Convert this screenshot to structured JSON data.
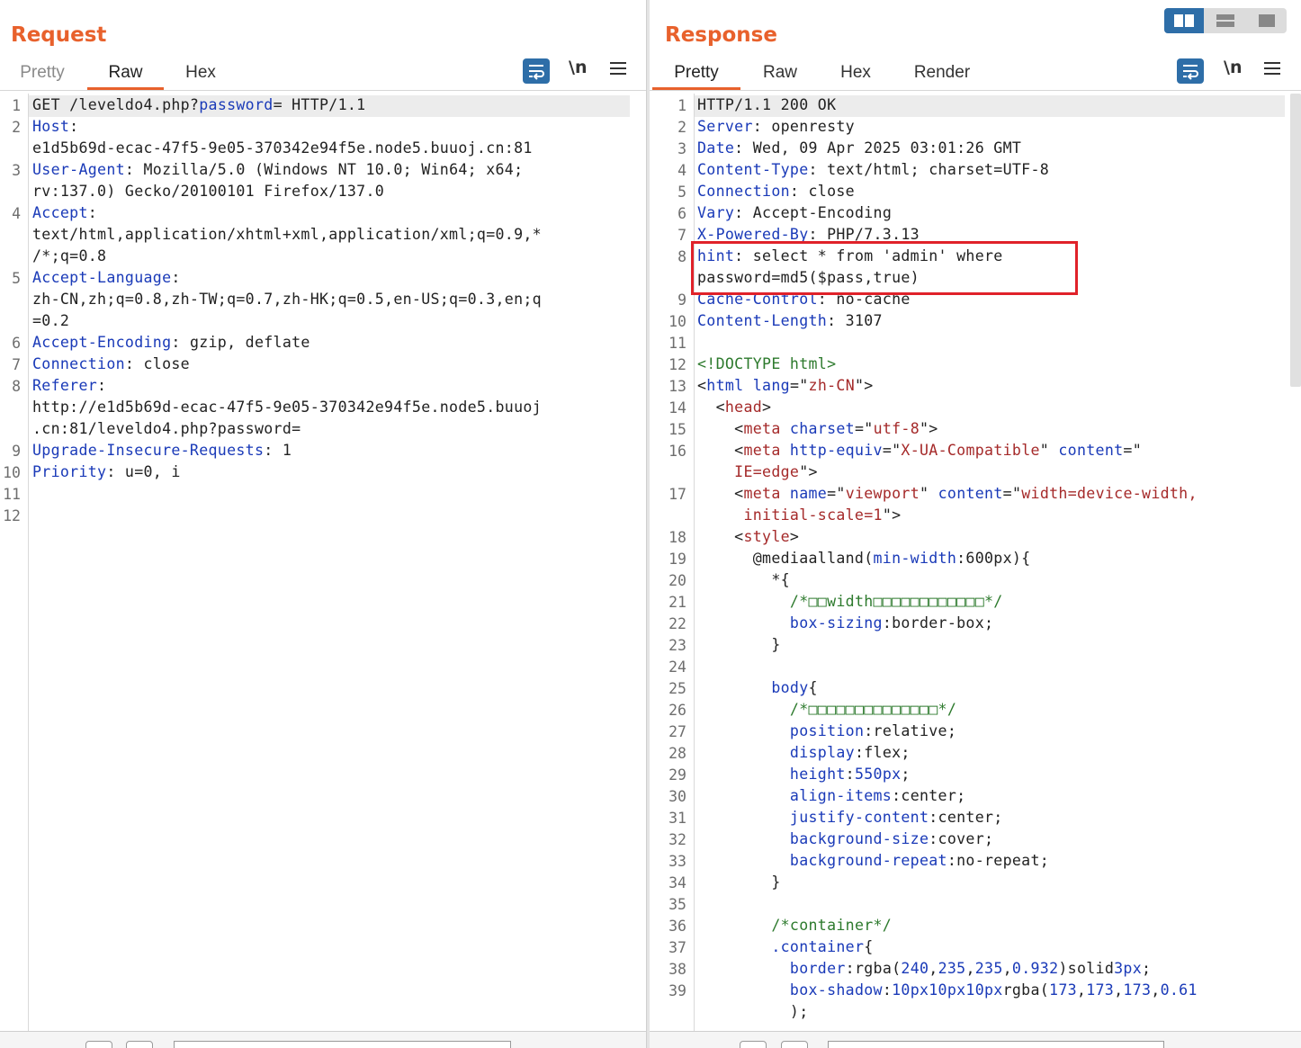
{
  "request": {
    "title": "Request",
    "tabs": [
      "Pretty",
      "Raw",
      "Hex"
    ],
    "active_tab": "Raw",
    "newline_toggle": "\\n",
    "lines": [
      {
        "n": "1",
        "segs": [
          [
            "",
            "GET /leveldo4.php?"
          ],
          [
            "k",
            "password"
          ],
          [
            "",
            "= HTTP/1.1"
          ]
        ]
      },
      {
        "n": "2",
        "segs": [
          [
            "k",
            "Host"
          ],
          [
            "",
            ":"
          ]
        ]
      },
      {
        "n": "",
        "segs": [
          [
            "",
            "e1d5b69d-ecac-47f5-9e05-370342e94f5e.node5.buuoj.cn:81"
          ]
        ]
      },
      {
        "n": "3",
        "segs": [
          [
            "k",
            "User-Agent"
          ],
          [
            "",
            ": Mozilla/5.0 (Windows NT 10.0; Win64; x64;"
          ]
        ]
      },
      {
        "n": "",
        "segs": [
          [
            "",
            "rv:137.0) Gecko/20100101 Firefox/137.0"
          ]
        ]
      },
      {
        "n": "4",
        "segs": [
          [
            "k",
            "Accept"
          ],
          [
            "",
            ":"
          ]
        ]
      },
      {
        "n": "",
        "segs": [
          [
            "",
            "text/html,application/xhtml+xml,application/xml;q=0.9,*"
          ]
        ]
      },
      {
        "n": "",
        "segs": [
          [
            "",
            "/*;q=0.8"
          ]
        ]
      },
      {
        "n": "5",
        "segs": [
          [
            "k",
            "Accept-Language"
          ],
          [
            "",
            ":"
          ]
        ]
      },
      {
        "n": "",
        "segs": [
          [
            "",
            "zh-CN,zh;q=0.8,zh-TW;q=0.7,zh-HK;q=0.5,en-US;q=0.3,en;q"
          ]
        ]
      },
      {
        "n": "",
        "segs": [
          [
            "",
            "=0.2"
          ]
        ]
      },
      {
        "n": "6",
        "segs": [
          [
            "k",
            "Accept-Encoding"
          ],
          [
            "",
            ": gzip, deflate"
          ]
        ]
      },
      {
        "n": "7",
        "segs": [
          [
            "k",
            "Connection"
          ],
          [
            "",
            ": close"
          ]
        ]
      },
      {
        "n": "8",
        "segs": [
          [
            "k",
            "Referer"
          ],
          [
            "",
            ":"
          ]
        ]
      },
      {
        "n": "",
        "segs": [
          [
            "",
            "http://e1d5b69d-ecac-47f5-9e05-370342e94f5e.node5.buuoj"
          ]
        ]
      },
      {
        "n": "",
        "segs": [
          [
            "",
            ".cn:81/leveldo4.php?password="
          ]
        ]
      },
      {
        "n": "9",
        "segs": [
          [
            "k",
            "Upgrade-Insecure-Requests"
          ],
          [
            "",
            ": 1"
          ]
        ]
      },
      {
        "n": "10",
        "segs": [
          [
            "k",
            "Priority"
          ],
          [
            "",
            ": u=0, i"
          ]
        ]
      },
      {
        "n": "11",
        "segs": []
      },
      {
        "n": "12",
        "segs": []
      }
    ]
  },
  "response": {
    "title": "Response",
    "tabs": [
      "Pretty",
      "Raw",
      "Hex",
      "Render"
    ],
    "active_tab": "Pretty",
    "newline_toggle": "\\n",
    "lines": [
      {
        "n": "1",
        "segs": [
          [
            "",
            "HTTP/1.1 200 OK"
          ]
        ]
      },
      {
        "n": "2",
        "segs": [
          [
            "k",
            "Server"
          ],
          [
            "",
            ": openresty"
          ]
        ]
      },
      {
        "n": "3",
        "segs": [
          [
            "k",
            "Date"
          ],
          [
            "",
            ": Wed, 09 Apr 2025 03:01:26 GMT"
          ]
        ]
      },
      {
        "n": "4",
        "segs": [
          [
            "k",
            "Content-Type"
          ],
          [
            "",
            ": text/html; charset=UTF-8"
          ]
        ]
      },
      {
        "n": "5",
        "segs": [
          [
            "k",
            "Connection"
          ],
          [
            "",
            ": close"
          ]
        ]
      },
      {
        "n": "6",
        "segs": [
          [
            "k",
            "Vary"
          ],
          [
            "",
            ": Accept-Encoding"
          ]
        ]
      },
      {
        "n": "7",
        "segs": [
          [
            "k",
            "X-Powered-By"
          ],
          [
            "",
            ": PHP/7.3.13"
          ]
        ]
      },
      {
        "n": "8",
        "segs": [
          [
            "k",
            "hint"
          ],
          [
            "",
            ": select * from 'admin' where"
          ]
        ]
      },
      {
        "n": "",
        "segs": [
          [
            "",
            "password=md5($pass,true)"
          ]
        ]
      },
      {
        "n": "9",
        "segs": [
          [
            "k",
            "Cache-Control"
          ],
          [
            "",
            ": no-cache"
          ]
        ]
      },
      {
        "n": "10",
        "segs": [
          [
            "k",
            "Content-Length"
          ],
          [
            "",
            ": 3107"
          ]
        ]
      },
      {
        "n": "11",
        "segs": []
      },
      {
        "n": "12",
        "segs": [
          [
            "g",
            "<!DOCTYPE html>"
          ]
        ]
      },
      {
        "n": "13",
        "segs": [
          [
            "",
            "<"
          ],
          [
            "k",
            "html"
          ],
          [
            "",
            " "
          ],
          [
            "k",
            "lang"
          ],
          [
            "",
            "=\""
          ],
          [
            "s",
            "zh-CN"
          ],
          [
            "",
            "\">"
          ]
        ]
      },
      {
        "n": "14",
        "segs": [
          [
            "",
            "  <"
          ],
          [
            "s",
            "head"
          ],
          [
            "",
            ">"
          ]
        ]
      },
      {
        "n": "15",
        "segs": [
          [
            "",
            "    <"
          ],
          [
            "s",
            "meta"
          ],
          [
            "",
            " "
          ],
          [
            "k",
            "charset"
          ],
          [
            "",
            "=\""
          ],
          [
            "s",
            "utf-8"
          ],
          [
            "",
            "\">"
          ]
        ]
      },
      {
        "n": "16",
        "segs": [
          [
            "",
            "    <"
          ],
          [
            "s",
            "meta"
          ],
          [
            "",
            " "
          ],
          [
            "k",
            "http-equiv"
          ],
          [
            "",
            "=\""
          ],
          [
            "s",
            "X-UA-Compatible"
          ],
          [
            "",
            "\" "
          ],
          [
            "k",
            "content"
          ],
          [
            "",
            "=\""
          ]
        ]
      },
      {
        "n": "",
        "segs": [
          [
            "",
            "    "
          ],
          [
            "s",
            "IE=edge"
          ],
          [
            "",
            "\">"
          ]
        ]
      },
      {
        "n": "17",
        "segs": [
          [
            "",
            "    <"
          ],
          [
            "s",
            "meta"
          ],
          [
            "",
            " "
          ],
          [
            "k",
            "name"
          ],
          [
            "",
            "=\""
          ],
          [
            "s",
            "viewport"
          ],
          [
            "",
            "\" "
          ],
          [
            "k",
            "content"
          ],
          [
            "",
            "=\""
          ],
          [
            "s",
            "width=device-width,"
          ]
        ]
      },
      {
        "n": "",
        "segs": [
          [
            "",
            "     "
          ],
          [
            "s",
            "initial-scale=1"
          ],
          [
            "",
            "\">"
          ]
        ]
      },
      {
        "n": "18",
        "segs": [
          [
            "",
            "    <"
          ],
          [
            "s",
            "style"
          ],
          [
            "",
            ">"
          ]
        ]
      },
      {
        "n": "19",
        "segs": [
          [
            "",
            "      @mediaalland("
          ],
          [
            "k",
            "min-width"
          ],
          [
            "",
            ":600px){"
          ]
        ]
      },
      {
        "n": "20",
        "segs": [
          [
            "",
            "        *{"
          ]
        ]
      },
      {
        "n": "21",
        "segs": [
          [
            "",
            "          "
          ],
          [
            "g",
            "/*□□width□□□□□□□□□□□□*/"
          ]
        ]
      },
      {
        "n": "22",
        "segs": [
          [
            "",
            "          "
          ],
          [
            "k",
            "box-sizing"
          ],
          [
            "",
            ":border-box;"
          ]
        ]
      },
      {
        "n": "23",
        "segs": [
          [
            "",
            "        }"
          ]
        ]
      },
      {
        "n": "24",
        "segs": []
      },
      {
        "n": "25",
        "segs": [
          [
            "",
            "        "
          ],
          [
            "k",
            "body"
          ],
          [
            "",
            "{"
          ]
        ]
      },
      {
        "n": "26",
        "segs": [
          [
            "",
            "          "
          ],
          [
            "g",
            "/*□□□□□□□□□□□□□□*/"
          ]
        ]
      },
      {
        "n": "27",
        "segs": [
          [
            "",
            "          "
          ],
          [
            "k",
            "position"
          ],
          [
            "",
            ":relative;"
          ]
        ]
      },
      {
        "n": "28",
        "segs": [
          [
            "",
            "          "
          ],
          [
            "k",
            "display"
          ],
          [
            "",
            ":flex;"
          ]
        ]
      },
      {
        "n": "29",
        "segs": [
          [
            "",
            "          "
          ],
          [
            "k",
            "height"
          ],
          [
            "",
            ":"
          ],
          [
            "n",
            "550px"
          ],
          [
            "",
            ";"
          ]
        ]
      },
      {
        "n": "30",
        "segs": [
          [
            "",
            "          "
          ],
          [
            "k",
            "align-items"
          ],
          [
            "",
            ":center;"
          ]
        ]
      },
      {
        "n": "31",
        "segs": [
          [
            "",
            "          "
          ],
          [
            "k",
            "justify-content"
          ],
          [
            "",
            ":center;"
          ]
        ]
      },
      {
        "n": "32",
        "segs": [
          [
            "",
            "          "
          ],
          [
            "k",
            "background-size"
          ],
          [
            "",
            ":cover;"
          ]
        ]
      },
      {
        "n": "33",
        "segs": [
          [
            "",
            "          "
          ],
          [
            "k",
            "background-repeat"
          ],
          [
            "",
            ":no-repeat;"
          ]
        ]
      },
      {
        "n": "34",
        "segs": [
          [
            "",
            "        }"
          ]
        ]
      },
      {
        "n": "35",
        "segs": []
      },
      {
        "n": "36",
        "segs": [
          [
            "",
            "        "
          ],
          [
            "g",
            "/*container*/"
          ]
        ]
      },
      {
        "n": "37",
        "segs": [
          [
            "",
            "        "
          ],
          [
            "k",
            ".container"
          ],
          [
            "",
            "{"
          ]
        ]
      },
      {
        "n": "38",
        "segs": [
          [
            "",
            "          "
          ],
          [
            "k",
            "border"
          ],
          [
            "",
            ":rgba("
          ],
          [
            "n",
            "240"
          ],
          [
            "",
            ","
          ],
          [
            "n",
            "235"
          ],
          [
            "",
            ","
          ],
          [
            "n",
            "235"
          ],
          [
            "",
            ","
          ],
          [
            "n",
            "0.932"
          ],
          [
            "",
            ")solid"
          ],
          [
            "n",
            "3px"
          ],
          [
            "",
            ";"
          ]
        ]
      },
      {
        "n": "39",
        "segs": [
          [
            "",
            "          "
          ],
          [
            "k",
            "box-shadow"
          ],
          [
            "",
            ":"
          ],
          [
            "n",
            "10px10px10px"
          ],
          [
            "",
            "rgba("
          ],
          [
            "n",
            "173"
          ],
          [
            "",
            ","
          ],
          [
            "n",
            "173"
          ],
          [
            "",
            ","
          ],
          [
            "n",
            "173"
          ],
          [
            "",
            ","
          ],
          [
            "n",
            "0.61"
          ]
        ]
      },
      {
        "n": "",
        "segs": [
          [
            "",
            "          );"
          ]
        ]
      }
    ]
  },
  "view_modes": [
    "split-vertical",
    "split-horizontal",
    "single"
  ],
  "accent_color": "#e8612c",
  "highlight_color": "#e0222a"
}
